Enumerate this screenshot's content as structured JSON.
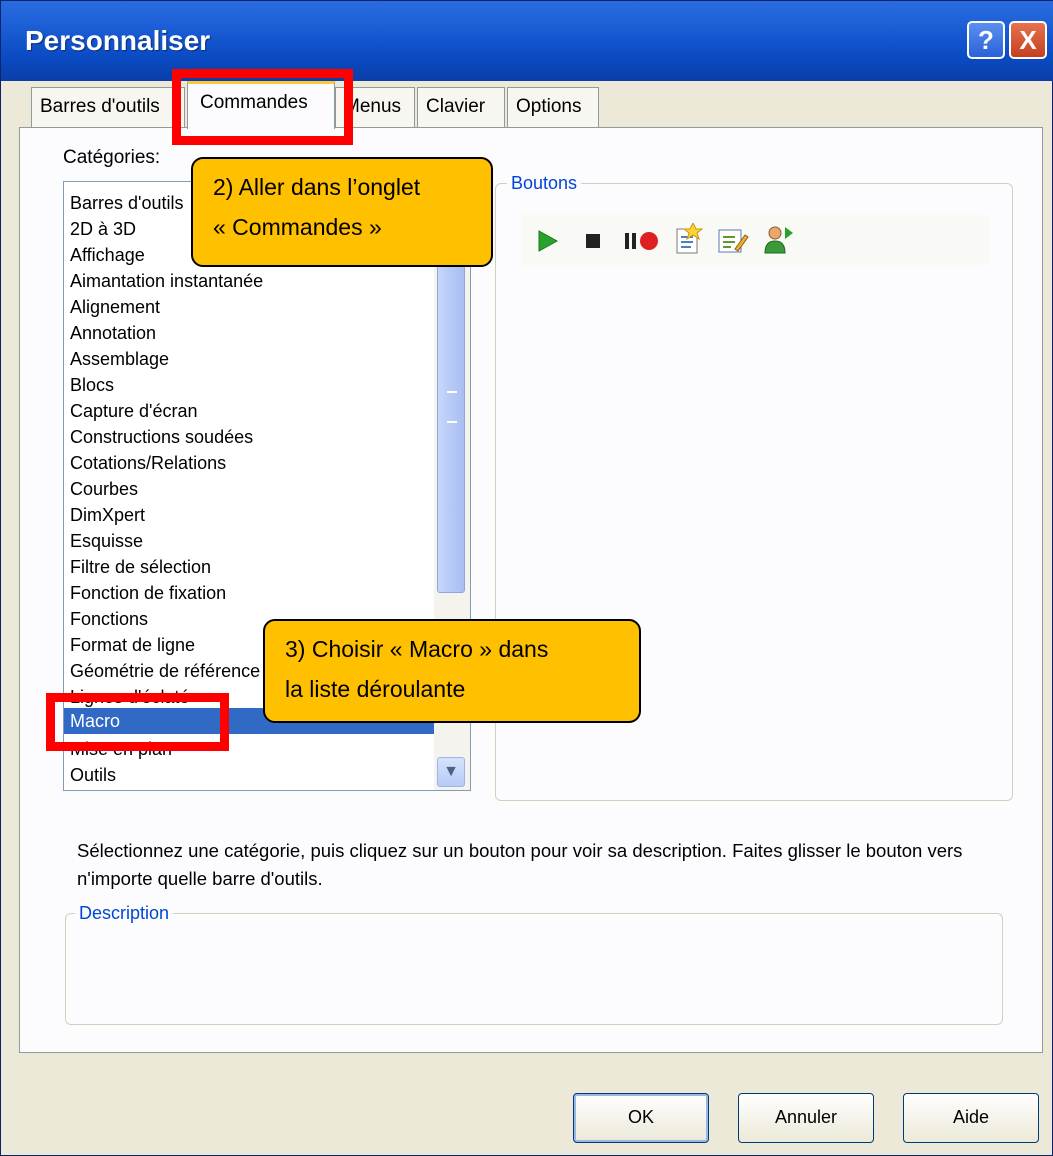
{
  "window": {
    "title": "Personnaliser",
    "help_glyph": "?",
    "close_glyph": "X"
  },
  "tabs": [
    {
      "label": "Barres d'outils"
    },
    {
      "label": "Commandes"
    },
    {
      "label": "Menus"
    },
    {
      "label": "Clavier"
    },
    {
      "label": "Options"
    }
  ],
  "categories": {
    "label": "Catégories:",
    "items": [
      "Barres d'outils",
      "2D à 3D",
      "Affichage",
      "Aimantation instantanée",
      "Alignement",
      "Annotation",
      "Assemblage",
      "Blocs",
      "Capture d'écran",
      "Constructions soudées",
      "Cotations/Relations",
      "Courbes",
      "DimXpert",
      "Esquisse",
      "Filtre de sélection",
      "Fonction de fixation",
      "Fonctions",
      "Format de ligne",
      "Géométrie de référence",
      "Lignes d'éclaté",
      "Macro",
      "Mise en plan",
      "Outils"
    ],
    "selected": "Macro",
    "scroll_down_glyph": "▼"
  },
  "buttons_group": {
    "legend": "Boutons",
    "icons": [
      "run-macro-icon",
      "stop-macro-icon",
      "record-pause-macro-icon",
      "new-macro-icon",
      "edit-macro-icon",
      "customize-macro-icon"
    ],
    "colors": {
      "run": "#2aa12a",
      "stop": "#222222",
      "record": "#e02020"
    }
  },
  "instructions": "Sélectionnez une catégorie, puis cliquez sur un bouton pour voir sa description. Faites glisser le bouton vers n'importe quelle barre d'outils.",
  "description_group": {
    "legend": "Description"
  },
  "footer": {
    "ok": "OK",
    "cancel": "Annuler",
    "help": "Aide"
  },
  "annotations": {
    "callout_tab": [
      "2) Aller dans l’onglet",
      "« Commandes »"
    ],
    "callout_macro": [
      "3) Choisir « Macro » dans",
      "la liste déroulante"
    ],
    "colors": {
      "callout_fill": "#ffc000",
      "highlight_box": "#ff0000"
    }
  }
}
